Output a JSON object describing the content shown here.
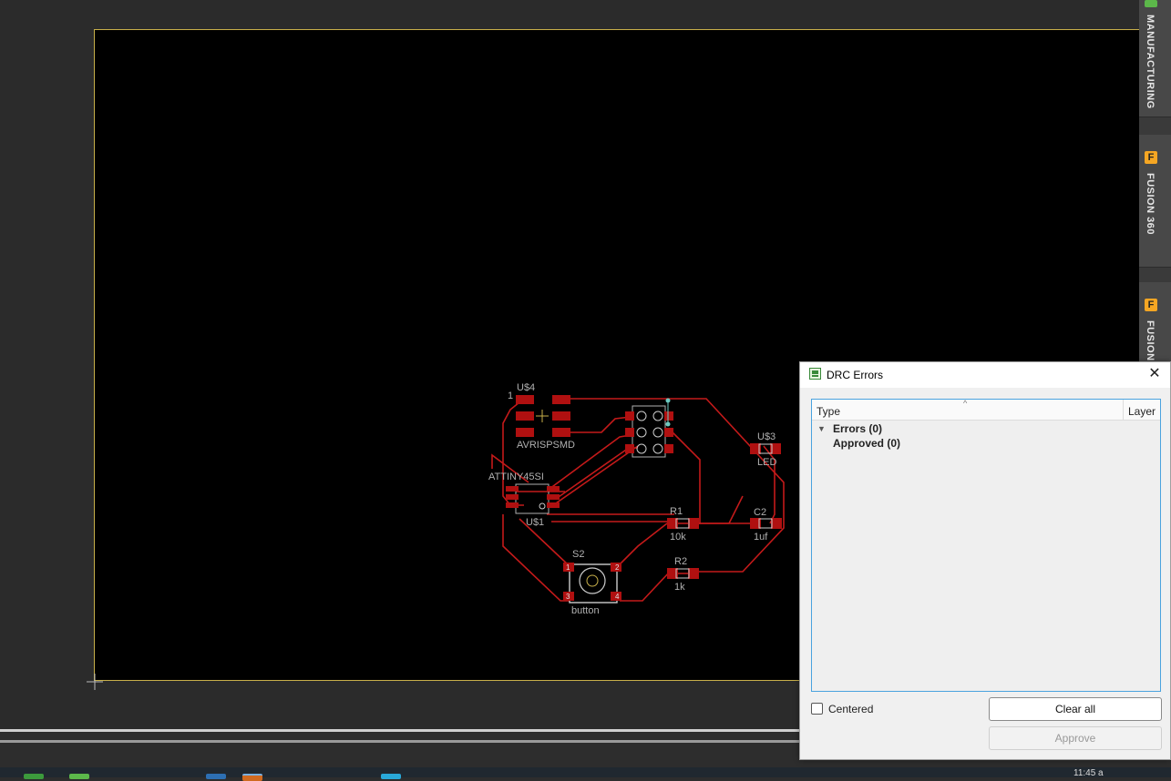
{
  "board": {
    "components": {
      "u4_name": "U$4",
      "u4_pin1": "1",
      "u4_value": "AVRISPSMD",
      "u1_value": "ATTINY45SI",
      "u1_name": "U$1",
      "u3_name": "U$3",
      "u3_value": "LED",
      "r1_name": "R1",
      "r1_value": "10k",
      "c2_name": "C2",
      "c2_value": "1uf",
      "r2_name": "R2",
      "r2_value": "1k",
      "s2_name": "S2",
      "s2_value": "button",
      "s2_pin1": "1",
      "s2_pin2": "2",
      "s2_pin3": "3",
      "s2_pin4": "4"
    },
    "colors": {
      "trace": "#c41a1a",
      "pad": "#b01010",
      "silkscreen": "#b0b0b0",
      "outline": "#c8b04a",
      "airwire": "#6cc9c0"
    }
  },
  "side_panel": {
    "tabs": [
      {
        "label": "MANUFACTURING",
        "icon": "manufacturing-icon",
        "color": "#5cb84a"
      },
      {
        "label": "FUSION 360",
        "icon": "fusion-icon",
        "color": "#f5a623"
      },
      {
        "label": "FUSION",
        "icon": "fusion-icon",
        "color": "#f5a623"
      }
    ]
  },
  "drc_dialog": {
    "title": "DRC Errors",
    "close_glyph": "✕",
    "columns": {
      "type": "Type",
      "layer": "Layer",
      "sort_glyph": "^"
    },
    "tree": {
      "errors": "Errors (0)",
      "approved": "Approved (0)",
      "expand_glyph": "▼"
    },
    "centered_label": "Centered",
    "centered_checked": false,
    "clear_all_label": "Clear all",
    "approve_label": "Approve"
  },
  "taskbar": {
    "clock": "11:45 a"
  }
}
